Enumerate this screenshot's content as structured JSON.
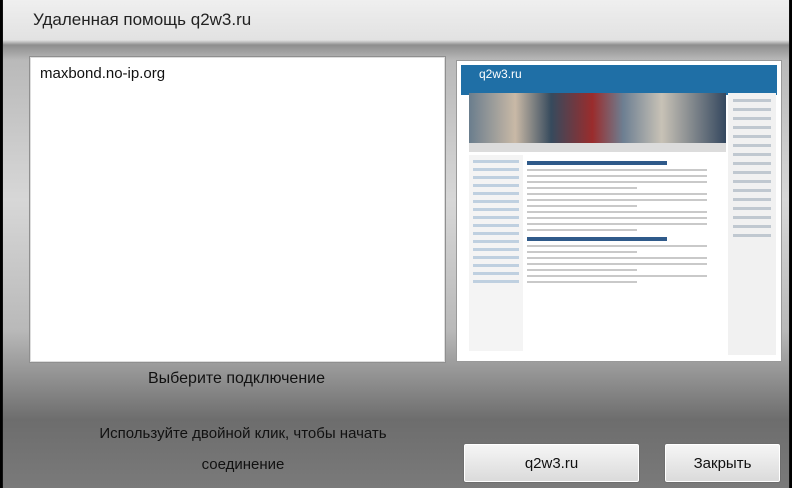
{
  "window": {
    "title": "Удаленная помощь q2w3.ru"
  },
  "connections": {
    "items": [
      "maxbond.no-ip.org"
    ]
  },
  "labels": {
    "select_connection": "Выберите подключение",
    "hint_line1": "Используйте двойной клик, чтобы начать",
    "hint_line2": "соединение"
  },
  "preview": {
    "site_logo": "q2w3.ru"
  },
  "buttons": {
    "site": "q2w3.ru",
    "close": "Закрыть"
  }
}
